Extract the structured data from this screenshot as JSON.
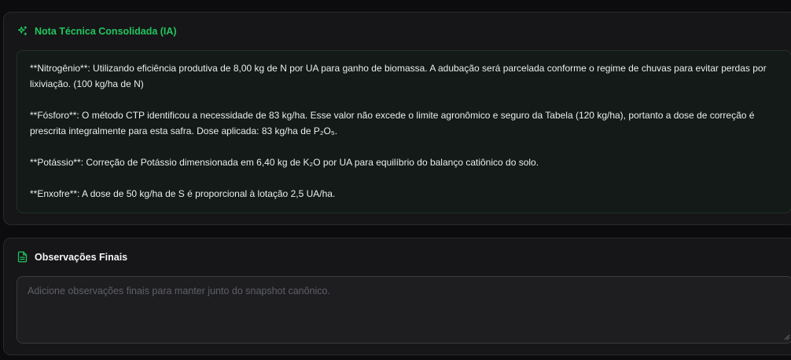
{
  "nota_tecnica": {
    "title": "Nota Técnica Consolidada (IA)",
    "icon": "sparkles-icon",
    "paragraphs": [
      {
        "id": "nitrogenio",
        "text": "**Nitrogênio**: Utilizando eficiência produtiva de 8,00 kg de N por UA para ganho de biomassa. A adubação será parcelada conforme o regime de chuvas para evitar perdas por lixiviação. (100 kg/ha de N)"
      },
      {
        "id": "fosforo",
        "text": "**Fósforo**: O método CTP identificou a necessidade de 83 kg/ha. Esse valor não excede o limite agronômico e seguro da Tabela (120 kg/ha), portanto a dose de correção é prescrita integralmente para esta safra. Dose aplicada: 83 kg/ha de P₂O₅."
      },
      {
        "id": "potassio",
        "text": "**Potássio**: Correção de Potássio dimensionada em 6,40 kg de K₂O por UA para equilíbrio do balanço catiônico do solo."
      },
      {
        "id": "enxofre",
        "text": "**Enxofre**: A dose de 50 kg/ha de S é proporcional à lotação 2,5 UA/ha."
      }
    ]
  },
  "observacoes": {
    "title": "Observações Finais",
    "icon": "document-icon",
    "value": "",
    "placeholder": "Adicione observações finais para manter junto do snapshot canônico."
  },
  "colors": {
    "accent": "#22c55e",
    "background": "#0c0c0e",
    "card": "#161618",
    "note_box": "#131a18"
  }
}
